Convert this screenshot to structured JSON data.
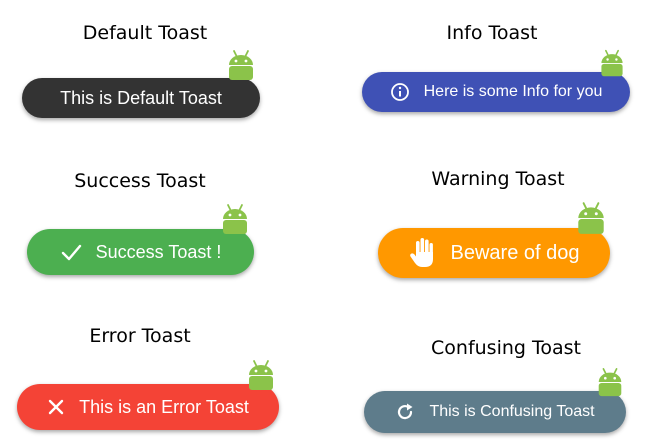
{
  "colors": {
    "default": "#333333",
    "info": "#3f51b5",
    "success": "#4caf50",
    "warning": "#ff9800",
    "error": "#f44336",
    "confusing": "#5e7c8b",
    "android": "#8bc34a"
  },
  "toasts": {
    "default": {
      "title": "Default Toast",
      "message": "This is Default Toast",
      "icon": "none"
    },
    "info": {
      "title": "Info Toast",
      "message": "Here is some Info for you",
      "icon": "info-circle-icon"
    },
    "success": {
      "title": "Success Toast",
      "message": "Success Toast !",
      "icon": "check-icon"
    },
    "warning": {
      "title": "Warning Toast",
      "message": "Beware of dog",
      "icon": "hand-icon"
    },
    "error": {
      "title": "Error Toast",
      "message": "This is an Error Toast",
      "icon": "close-icon"
    },
    "confusing": {
      "title": "Confusing Toast",
      "message": "This is Confusing Toast",
      "icon": "refresh-icon"
    }
  }
}
